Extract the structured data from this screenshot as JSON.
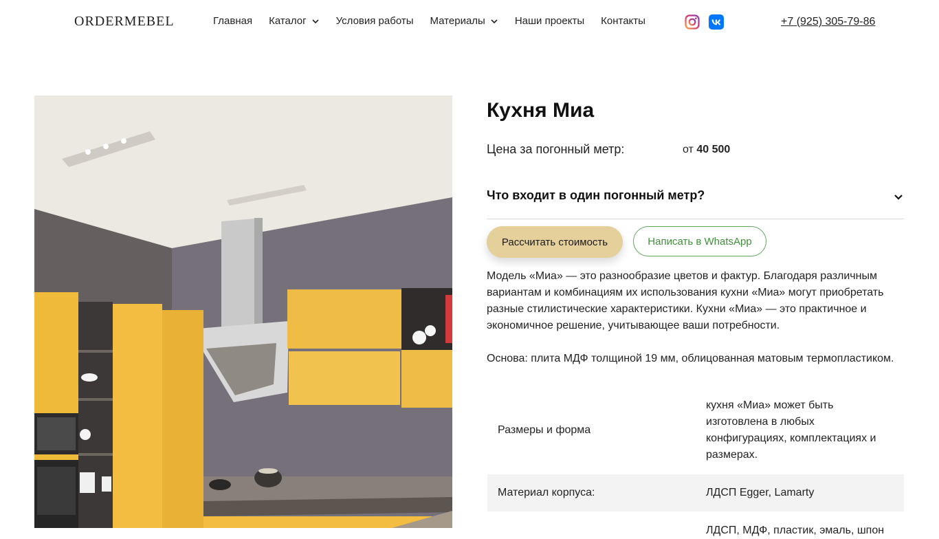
{
  "header": {
    "logo": "ORDERMEBEL",
    "nav": [
      {
        "label": "Главная",
        "has_dropdown": false
      },
      {
        "label": "Каталог",
        "has_dropdown": true
      },
      {
        "label": "Условия работы",
        "has_dropdown": false
      },
      {
        "label": "Материалы",
        "has_dropdown": true
      },
      {
        "label": "Наши проекты",
        "has_dropdown": false
      },
      {
        "label": "Контакты",
        "has_dropdown": false
      }
    ],
    "social": [
      "instagram-icon",
      "vk-icon"
    ],
    "phone": "+7 (925) 305-79-86"
  },
  "product": {
    "title": "Кухня Миа",
    "price_label": "Цена за погонный метр:",
    "price_prefix": "от",
    "price_value": "40 500",
    "price_currency": "",
    "faq_question": "Что входит в один погонный метр?",
    "btn_calc": "Рассчитать стоимость",
    "btn_whatsapp": "Написать в WhatsApp",
    "description": [
      "Модель «Миа» — это разнообразие цветов и фактур. Благодаря различным вариантам и комбинациям их использования кухни «Миа» могут приобретать разные стилистические характеристики. Кухни «Миа» — это практичное и экономичное решение, учитывающее ваши потребности.",
      "Основа: плита МДФ толщиной 19 мм, облицованная матовым термопластиком."
    ],
    "specs": [
      {
        "key": "Размеры и форма",
        "value": "кухня «Миа» может быть изготовлена в любых конфигурациях, комплектациях и размерах."
      },
      {
        "key": "Материал корпуса:",
        "value": "ЛДСП Egger, Lamarty"
      },
      {
        "key": "",
        "value": "ЛДСП, МДФ, пластик, эмаль, шпон"
      }
    ]
  },
  "colors": {
    "accent_button": "#e5cf9a",
    "whatsapp_green": "#3f8f3a",
    "cabinet_yellow": "#efb93a",
    "wall_gray": "#76707a"
  }
}
